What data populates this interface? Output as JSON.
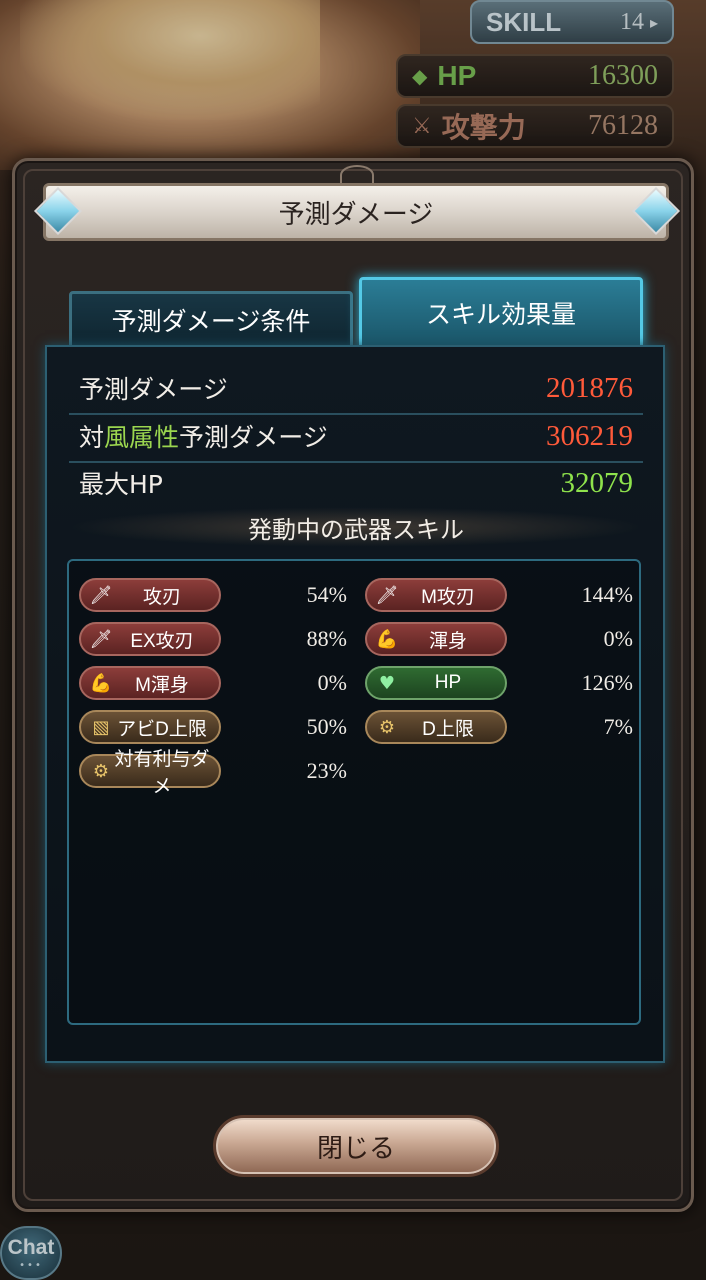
{
  "background": {
    "skill": {
      "label": "SKILL",
      "count": "14"
    },
    "hp": {
      "label": "HP",
      "value": "16300"
    },
    "attack": {
      "label": "攻撃力",
      "value": "76128"
    },
    "chat_label": "Chat"
  },
  "modal": {
    "title": "予測ダメージ",
    "tabs": [
      {
        "label": "予測ダメージ条件",
        "active": false
      },
      {
        "label": "スキル効果量",
        "active": true
      }
    ],
    "rows": [
      {
        "label": "予測ダメージ",
        "value": "201876",
        "color": "#ff5a3a"
      },
      {
        "label_prefix": "対",
        "label_highlight": "風属性",
        "label_suffix": "予測ダメージ",
        "value": "306219",
        "color": "#ff5a3a"
      },
      {
        "label": "最大HP",
        "value": "32079",
        "color": "#8fe34c"
      }
    ],
    "section_title": "発動中の武器スキル",
    "skills": [
      {
        "name": "攻刃",
        "percent": "54%",
        "icon": "sword-icon",
        "style": "red"
      },
      {
        "name": "M攻刃",
        "percent": "144%",
        "icon": "sword-icon",
        "style": "red"
      },
      {
        "name": "EX攻刃",
        "percent": "88%",
        "icon": "sword-icon",
        "style": "red"
      },
      {
        "name": "渾身",
        "percent": "0%",
        "icon": "flex-arm-icon",
        "style": "red"
      },
      {
        "name": "M渾身",
        "percent": "0%",
        "icon": "flex-arm-icon",
        "style": "red"
      },
      {
        "name": "HP",
        "percent": "126%",
        "icon": "heart-icon",
        "style": "green"
      },
      {
        "name": "アビD上限",
        "percent": "50%",
        "icon": "ability-icon",
        "style": "gold"
      },
      {
        "name": "D上限",
        "percent": "7%",
        "icon": "gear-icon",
        "style": "gold"
      },
      {
        "name": "対有利与ダメ",
        "percent": "23%",
        "icon": "gear-icon",
        "style": "gold"
      }
    ],
    "close_label": "閉じる"
  }
}
